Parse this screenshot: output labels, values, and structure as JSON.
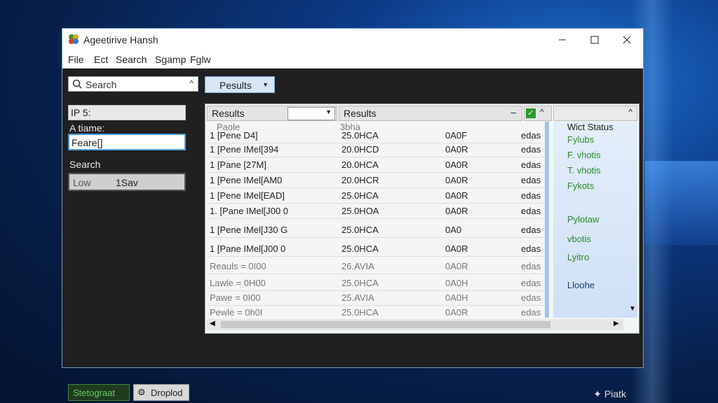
{
  "window": {
    "title": "Ageetirive Hansh"
  },
  "menu": [
    "File",
    "Ect",
    "Search",
    "Sgamp",
    "Fglw"
  ],
  "toolbar": {
    "search_placeholder": "Search",
    "results_button": "Pesults"
  },
  "sidebar": {
    "field1": "IP 5:",
    "label1": "A tiame:",
    "field2": "Feare[]",
    "search_label": "Search",
    "level_left": "Low",
    "level_right": "1Sav"
  },
  "table": {
    "col1": "Results",
    "col2": "Results",
    "col3": "",
    "col4": "Wict Status",
    "ghost_row": {
      "c1": "Paole",
      "c2": "3bha",
      "c3": ""
    },
    "rows": [
      {
        "c1": "1 [Pene D4]",
        "c2": "25.0HCA",
        "c3": "0A0F",
        "c4": "edas"
      },
      {
        "c1": "1 [Pene IMel[394",
        "c2": "20.0HCD",
        "c3": "0A0R",
        "c4": "edas"
      },
      {
        "c1": "1 [Pane [27M]",
        "c2": "20.0HCA",
        "c3": "0A0R",
        "c4": "edas"
      },
      {
        "c1": "1 [Pene IMel[AM0",
        "c2": "20.0HCR",
        "c3": "0A0R",
        "c4": "edas"
      },
      {
        "c1": "1 [Pene IMel[EAD]",
        "c2": "25.0HCA",
        "c3": "0A0R",
        "c4": "edas"
      },
      {
        "c1": "1. [Pane IMel[J00 0",
        "c2": "25.0HOA",
        "c3": "0A0R",
        "c4": "edas"
      },
      {
        "c1": "1 [Pene IMel[J30 G",
        "c2": "25.0HCA",
        "c3": "0A0",
        "c4": "edas"
      },
      {
        "c1": "1 [Pane IMel[J00 0",
        "c2": "25.0HCA",
        "c3": "0A0R",
        "c4": "edas"
      },
      {
        "c1": "Reauls = 0I00",
        "c2": "26.AVIA",
        "c3": "0A0R",
        "c4": "edas"
      },
      {
        "c1": "Lawle = 0H00",
        "c2": "25.0HCA",
        "c3": "0A0H",
        "c4": "edas"
      },
      {
        "c1": "Pawe = 0I00",
        "c2": "25.AVIA",
        "c3": "0A0H",
        "c4": "edas"
      },
      {
        "c1": "Pewle = 0h0I",
        "c2": "25.0HCA",
        "c3": "0A0R",
        "c4": "edas"
      }
    ],
    "status_items": [
      "Fylubs",
      "F. vhotis",
      "T. vhotis",
      "Fykots",
      "",
      "Pylotaw",
      "vbotis",
      "Lyitro",
      "Lloohe"
    ]
  },
  "footer": {
    "left_button": "Stetograat",
    "mid_button": "Droplod",
    "status": "Piatk"
  }
}
